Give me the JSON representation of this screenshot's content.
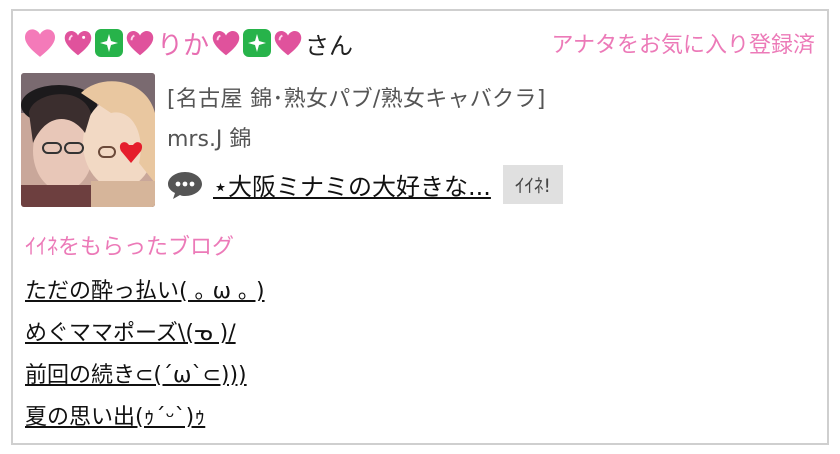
{
  "profile": {
    "name": "りか",
    "name_suffix": "さん",
    "favorite_link": "アナタをお気に入り登録済",
    "accent_color": "#ec7ab8"
  },
  "shop": {
    "category": "[名古屋 錦･熟女パブ/熟女キャバクラ]",
    "name": "mrs.J 錦",
    "photo_icon": "profile-photo"
  },
  "latest_post": {
    "icon": "speech-bubble-icon",
    "title": "⋆大阪ミナミの大好きな...",
    "like_button": "ｲｲﾈ!"
  },
  "liked_blogs": {
    "heading": "ｲｲﾈをもらったブログ",
    "items": [
      "ただの酔っ払い( ｡ ω ｡ )",
      "めぐママポーズ\\(ᓀ )/",
      "前回の続き⊂(´ω`⊂)))",
      "夏の思い出(ｩ´ᵕ`)ｩ"
    ]
  }
}
